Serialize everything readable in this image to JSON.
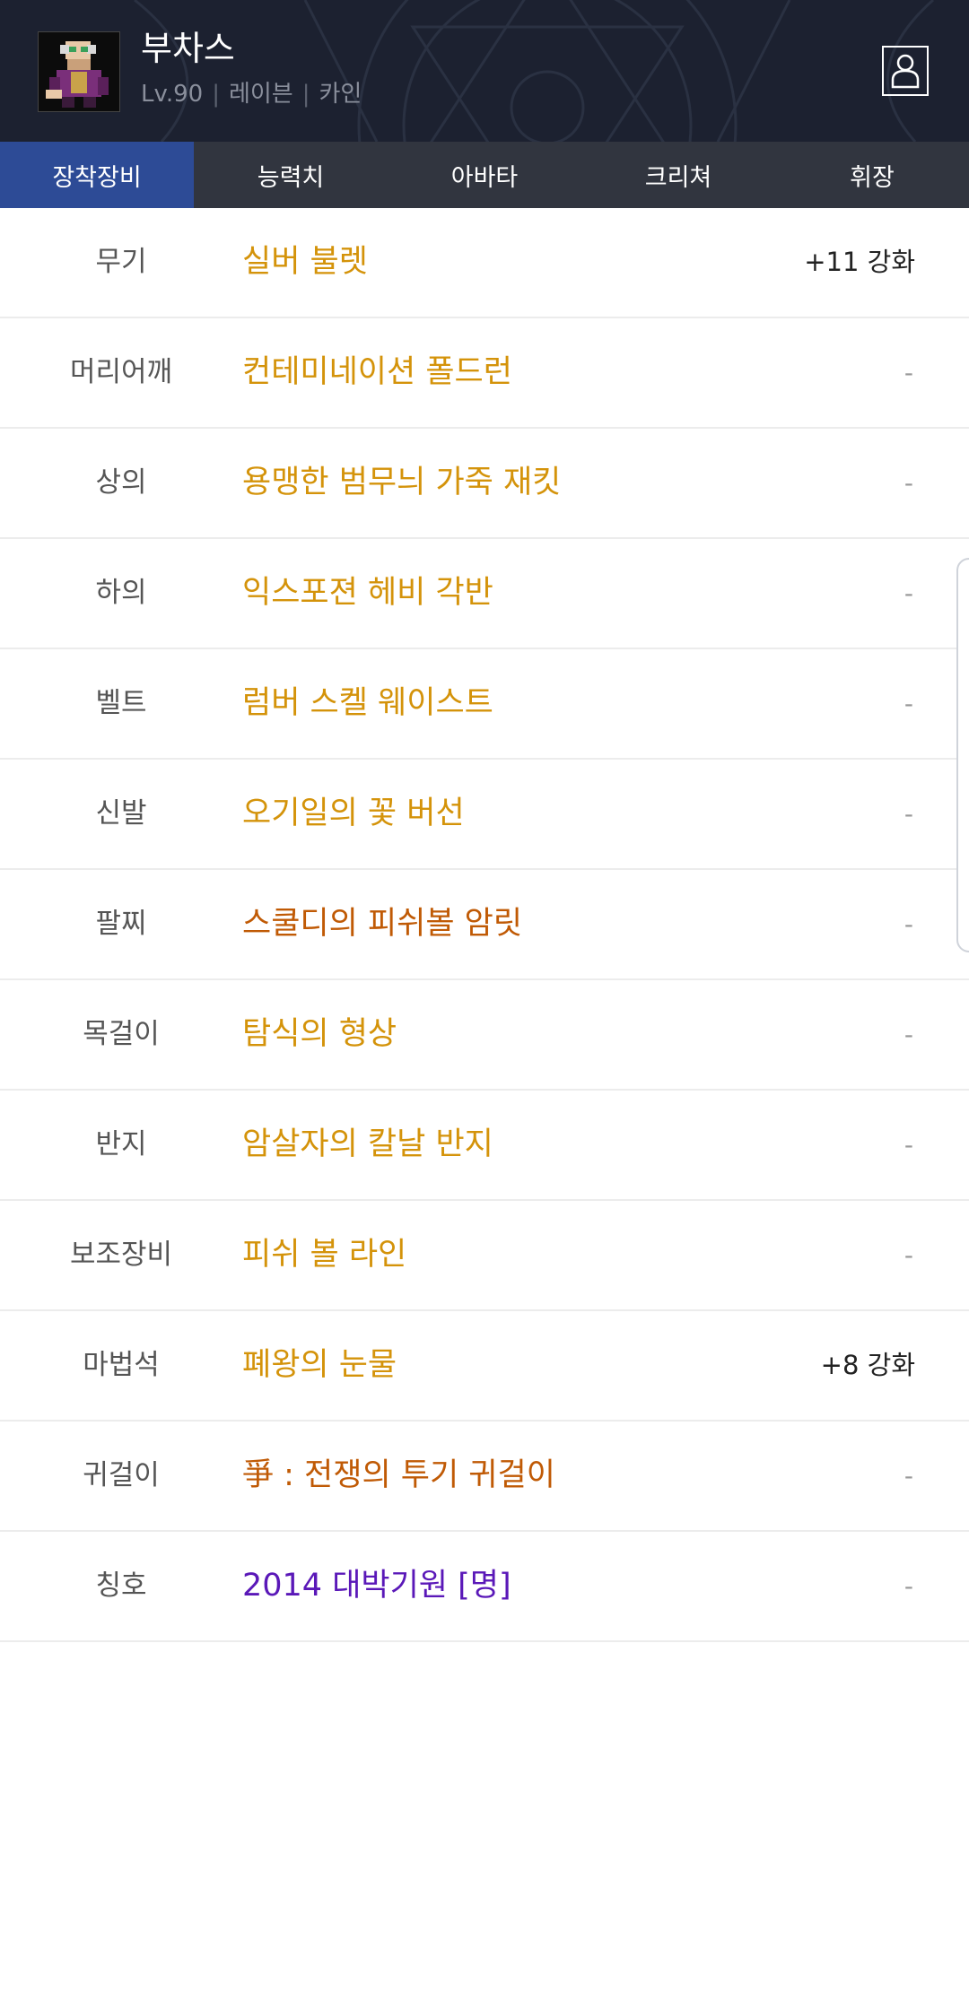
{
  "header": {
    "character_name": "부차스",
    "level": "Lv.90",
    "job": "레이븐",
    "server": "카인",
    "separator": "|"
  },
  "tabs": [
    {
      "label": "장착장비",
      "active": true
    },
    {
      "label": "능력치",
      "active": false
    },
    {
      "label": "아바타",
      "active": false
    },
    {
      "label": "크리쳐",
      "active": false
    },
    {
      "label": "휘장",
      "active": false
    }
  ],
  "equipment": [
    {
      "slot": "무기",
      "item": "실버 불렛",
      "enhance": "+11 강화",
      "color": "#d4930a"
    },
    {
      "slot": "머리어깨",
      "item": "컨테미네이션 폴드런",
      "enhance": "-",
      "color": "#d4930a"
    },
    {
      "slot": "상의",
      "item": "용맹한 범무늬 가죽 재킷",
      "enhance": "-",
      "color": "#d4930a"
    },
    {
      "slot": "하의",
      "item": "익스포젼 헤비 각반",
      "enhance": "-",
      "color": "#d4930a"
    },
    {
      "slot": "벨트",
      "item": "럼버 스켈 웨이스트",
      "enhance": "-",
      "color": "#d4930a"
    },
    {
      "slot": "신발",
      "item": "오기일의 꽃 버선",
      "enhance": "-",
      "color": "#d4930a"
    },
    {
      "slot": "팔찌",
      "item": "스쿨디의 피쉬볼 암릿",
      "enhance": "-",
      "color": "#c05a05"
    },
    {
      "slot": "목걸이",
      "item": "탐식의 형상",
      "enhance": "-",
      "color": "#d4930a"
    },
    {
      "slot": "반지",
      "item": "암살자의 칼날 반지",
      "enhance": "-",
      "color": "#d4930a"
    },
    {
      "slot": "보조장비",
      "item": "피쉬 볼 라인",
      "enhance": "-",
      "color": "#d4930a"
    },
    {
      "slot": "마법석",
      "item": "폐왕의 눈물",
      "enhance": "+8 강화",
      "color": "#d4930a"
    },
    {
      "slot": "귀걸이",
      "item": "爭 : 전쟁의 투기 귀걸이",
      "enhance": "-",
      "color": "#c05a05"
    },
    {
      "slot": "칭호",
      "item": "2014 대박기원 [명]",
      "enhance": "-",
      "color": "#5a18b8"
    }
  ],
  "icons": {
    "profile": "profile-icon",
    "avatar": "character-avatar"
  },
  "colors": {
    "header_bg": "#1c2130",
    "tab_bg": "#31353f",
    "tab_active": "#2d4b96",
    "epic": "#d4930a",
    "legendary": "#c05a05",
    "unique": "#5a18b8"
  }
}
